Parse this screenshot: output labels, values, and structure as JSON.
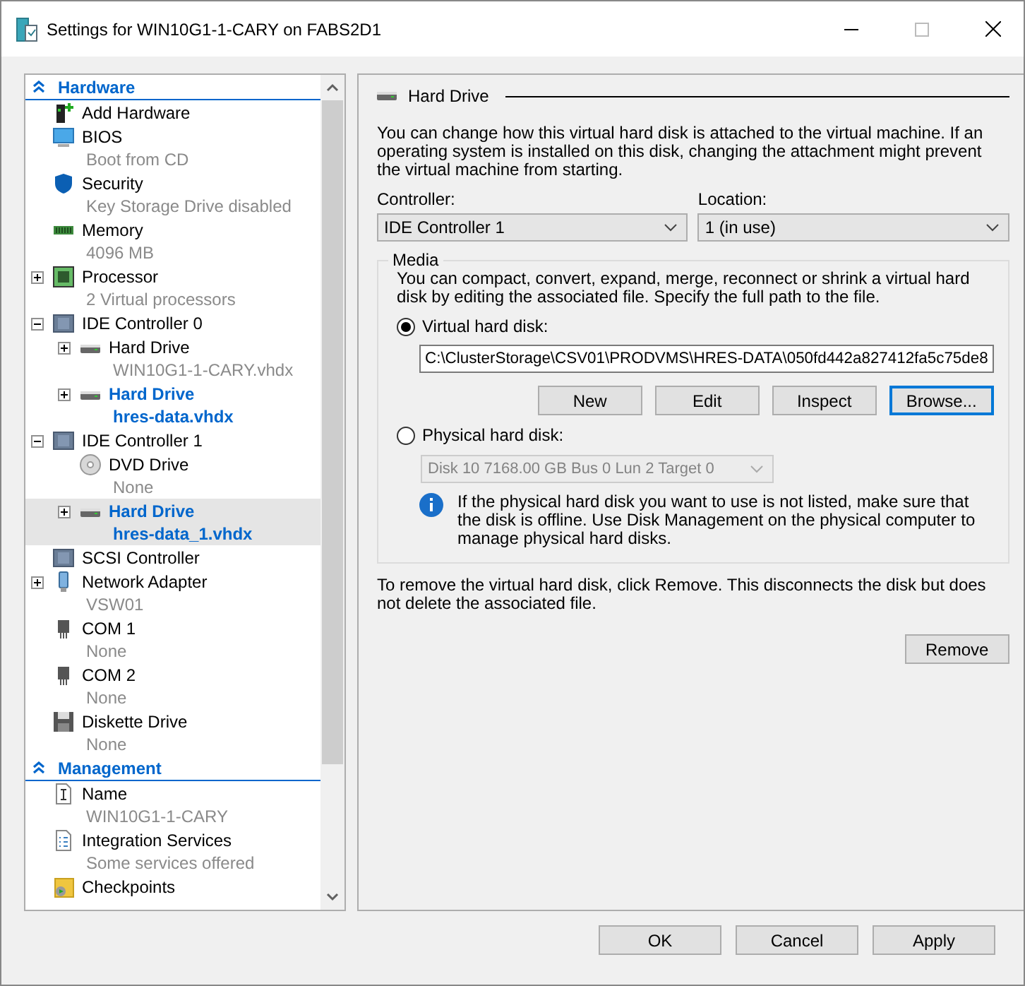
{
  "window": {
    "title": "Settings for WIN10G1-1-CARY on FABS2D1"
  },
  "sidebar": {
    "sections": [
      {
        "title": "Hardware",
        "expanded": true,
        "items": [
          {
            "kind": "add-hardware",
            "label": "Add Hardware",
            "changed": false,
            "selected": false
          },
          {
            "kind": "bios",
            "label": "BIOS",
            "sub": "Boot from CD",
            "changed": false,
            "selected": false
          },
          {
            "kind": "security",
            "label": "Security",
            "sub": "Key Storage Drive disabled",
            "changed": false,
            "selected": false
          },
          {
            "kind": "memory",
            "label": "Memory",
            "sub": "4096 MB",
            "changed": false,
            "selected": false
          },
          {
            "kind": "processor",
            "label": "Processor",
            "sub": "2 Virtual processors",
            "changed": false,
            "selected": false,
            "expanded": false
          },
          {
            "kind": "controller",
            "label": "IDE Controller 0",
            "changed": false,
            "selected": false,
            "expanded": true,
            "children": [
              {
                "kind": "hard-drive",
                "label": "Hard Drive",
                "sub": "WIN10G1-1-CARY.vhdx",
                "changed": false,
                "selected": false,
                "expanded": false
              },
              {
                "kind": "hard-drive",
                "label": "Hard Drive",
                "sub": "hres-data.vhdx",
                "changed": true,
                "selected": false,
                "expanded": false
              }
            ]
          },
          {
            "kind": "controller",
            "label": "IDE Controller 1",
            "changed": false,
            "selected": false,
            "expanded": true,
            "children": [
              {
                "kind": "dvd",
                "label": "DVD Drive",
                "sub": "None",
                "changed": false,
                "selected": false
              },
              {
                "kind": "hard-drive",
                "label": "Hard Drive",
                "sub": "hres-data_1.vhdx",
                "changed": true,
                "selected": true,
                "expanded": false
              }
            ]
          },
          {
            "kind": "scsi",
            "label": "SCSI Controller",
            "changed": false,
            "selected": false
          },
          {
            "kind": "network",
            "label": "Network Adapter",
            "sub": "VSW01",
            "changed": false,
            "selected": false,
            "expanded": false
          },
          {
            "kind": "com",
            "label": "COM 1",
            "sub": "None",
            "changed": false,
            "selected": false
          },
          {
            "kind": "com",
            "label": "COM 2",
            "sub": "None",
            "changed": false,
            "selected": false
          },
          {
            "kind": "diskette",
            "label": "Diskette Drive",
            "sub": "None",
            "changed": false,
            "selected": false
          }
        ]
      },
      {
        "title": "Management",
        "expanded": true,
        "items": [
          {
            "kind": "name",
            "label": "Name",
            "sub": "WIN10G1-1-CARY",
            "changed": false,
            "selected": false
          },
          {
            "kind": "integration",
            "label": "Integration Services",
            "sub": "Some services offered",
            "changed": false,
            "selected": false
          },
          {
            "kind": "checkpoints",
            "label": "Checkpoints",
            "changed": false,
            "selected": false
          }
        ]
      }
    ]
  },
  "panel": {
    "title": "Hard Drive",
    "intro": "You can change how this virtual hard disk is attached to the virtual machine. If an operating system is installed on this disk, changing the attachment might prevent the virtual machine from starting.",
    "controller": {
      "label": "Controller:",
      "value": "IDE Controller 1"
    },
    "location": {
      "label": "Location:",
      "value": "1 (in use)"
    },
    "media": {
      "title": "Media",
      "description": "You can compact, convert, expand, merge, reconnect or shrink a virtual hard disk by editing the associated file. Specify the full path to the file.",
      "options": [
        {
          "kind": "virtual",
          "label": "Virtual hard disk:",
          "selected": true,
          "path": "C:\\ClusterStorage\\CSV01\\PRODVMS\\HRES-DATA\\050fd442a827412fa5c75de8",
          "buttons": [
            {
              "label": "New",
              "focused": false
            },
            {
              "label": "Edit",
              "focused": false
            },
            {
              "label": "Inspect",
              "focused": false
            },
            {
              "label": "Browse...",
              "focused": true
            }
          ]
        },
        {
          "kind": "physical",
          "label": "Physical hard disk:",
          "selected": false,
          "disk": "Disk 10 7168.00 GB Bus 0 Lun 2 Target 0",
          "disabled": true,
          "info": "If the physical hard disk you want to use is not listed, make sure that the disk is offline. Use Disk Management on the physical computer to manage physical hard disks."
        }
      ]
    },
    "remove_note": "To remove the virtual hard disk, click Remove. This disconnects the disk but does not delete the associated file.",
    "remove_button": "Remove"
  },
  "buttons": [
    "OK",
    "Cancel",
    "Apply"
  ]
}
